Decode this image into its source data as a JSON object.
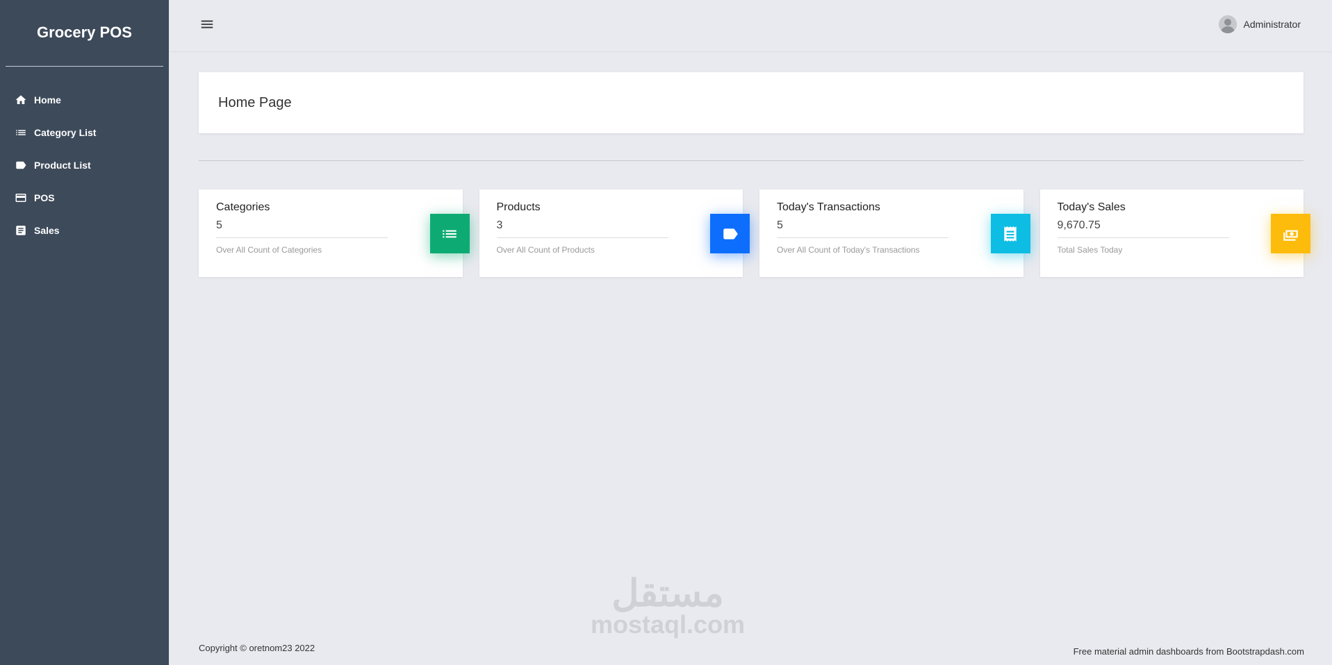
{
  "app": {
    "title": "Grocery POS"
  },
  "sidebar": {
    "items": [
      {
        "label": "Home",
        "icon": "home-icon"
      },
      {
        "label": "Category List",
        "icon": "list-icon"
      },
      {
        "label": "Product List",
        "icon": "tag-icon"
      },
      {
        "label": "POS",
        "icon": "credit-card-icon"
      },
      {
        "label": "Sales",
        "icon": "receipt-icon"
      }
    ]
  },
  "header": {
    "menu_icon": "menu-icon",
    "user_name": "Administrator",
    "avatar_icon": "user-avatar-icon"
  },
  "page": {
    "title": "Home Page"
  },
  "cards": [
    {
      "title": "Categories",
      "value": "5",
      "note": "Over All Count of Categories",
      "icon": "list-icon",
      "color": "#0dab73"
    },
    {
      "title": "Products",
      "value": "3",
      "note": "Over All Count of Products",
      "icon": "tag-icon",
      "color": "#0d6efd"
    },
    {
      "title": "Today's Transactions",
      "value": "5",
      "note": "Over All Count of Today's Transactions",
      "icon": "receipt-icon",
      "color": "#0dbde3"
    },
    {
      "title": "Today's Sales",
      "value": "9,670.75",
      "note": "Total Sales Today",
      "icon": "cash-icon",
      "color": "#fdbb0b"
    }
  ],
  "watermark": {
    "arabic": "مستقل",
    "latin": "mostaql.com"
  },
  "footer": {
    "copyright": "Copyright © oretnom23 2022",
    "credit": "Free material admin dashboards from Bootstrapdash.com"
  },
  "colors": {
    "sidebar": "#3d4a5a",
    "background": "#e9eaef"
  }
}
